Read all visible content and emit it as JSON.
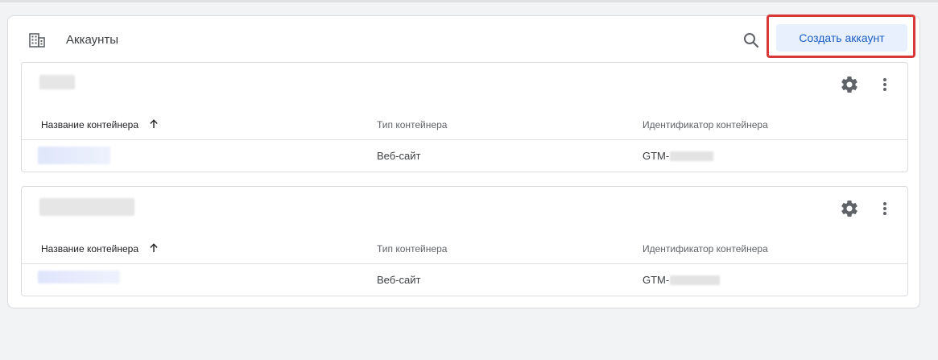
{
  "panel": {
    "title": "Аккаунты",
    "create_button_label": "Создать аккаунт"
  },
  "table_headers": {
    "name": "Название контейнера",
    "type": "Тип контейнера",
    "id": "Идентификатор контейнера"
  },
  "accounts": [
    {
      "containers": [
        {
          "type": "Веб-сайт",
          "id_prefix": "GTM-"
        }
      ]
    },
    {
      "containers": [
        {
          "type": "Веб-сайт",
          "id_prefix": "GTM-"
        }
      ]
    }
  ],
  "icons": {
    "panel": "building-icon",
    "search": "search-icon",
    "settings": "gear-icon",
    "menu": "more-vert-icon",
    "sort": "arrow-up-icon"
  },
  "colors": {
    "accent_text": "#1a5fc7",
    "button_bg": "#e8f0fe",
    "highlight_border": "#d93838"
  }
}
